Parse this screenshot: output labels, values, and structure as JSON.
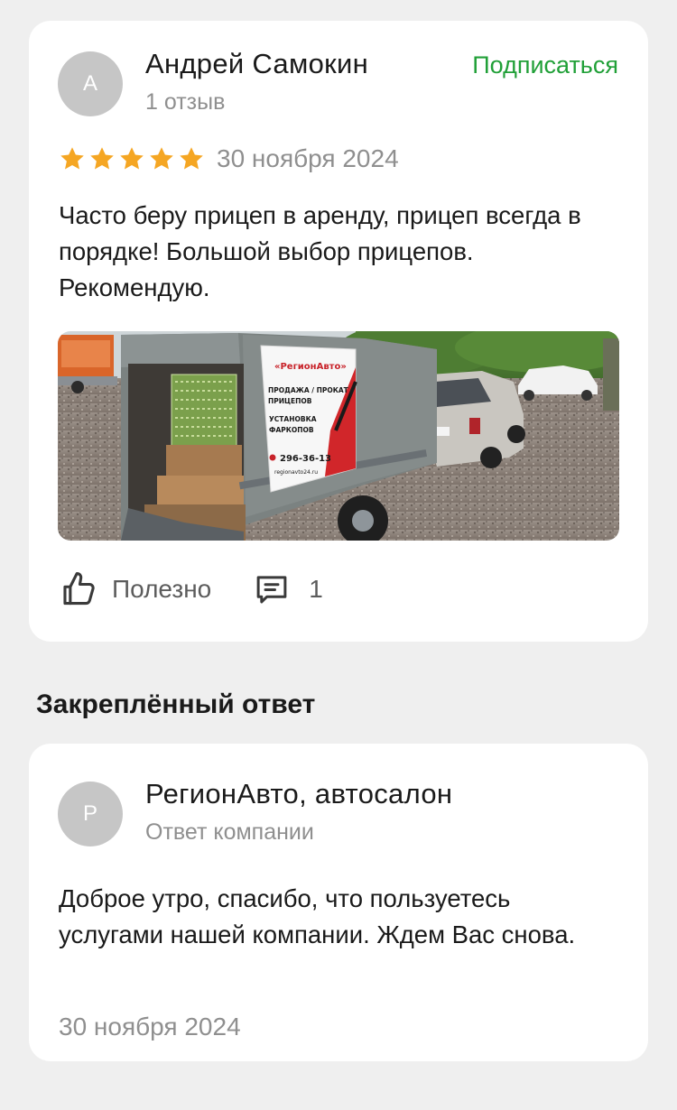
{
  "review": {
    "author": {
      "initial": "А",
      "name": "Андрей Самокин",
      "reviews_count": "1 отзыв"
    },
    "subscribe_label": "Подписаться",
    "rating": 5,
    "date": "30 ноября 2024",
    "text": "Часто беру прицеп в аренду, прицеп всегда в порядке! Большой выбор прицепов. Рекомендую.",
    "photo": {
      "banner_brand": "«РегионАвто»",
      "banner_line1": "ПРОДАЖА / ПРОКАТ",
      "banner_line2": "ПРИЦЕПОВ",
      "banner_line3": "УСТАНОВКА",
      "banner_line4": "ФАРКОПОВ",
      "banner_phone": "296-36-13",
      "banner_site": "regionavto24.ru"
    },
    "actions": {
      "useful_label": "Полезно",
      "comments_count": "1"
    }
  },
  "pinned_section_title": "Закреплённый ответ",
  "reply": {
    "author": {
      "initial": "Р",
      "name": "РегионАвто, автосалон",
      "role": "Ответ компании"
    },
    "text": "Доброе утро, спасибо, что пользуетесь услугами нашей компании. Ждем Вас снова.",
    "date": "30 ноября 2024"
  },
  "colors": {
    "accent_green": "#21a038",
    "star_orange": "#f5a623",
    "muted_text": "#8f8f8f",
    "avatar_gray": "#c6c6c6",
    "page_bg": "#efefef"
  }
}
